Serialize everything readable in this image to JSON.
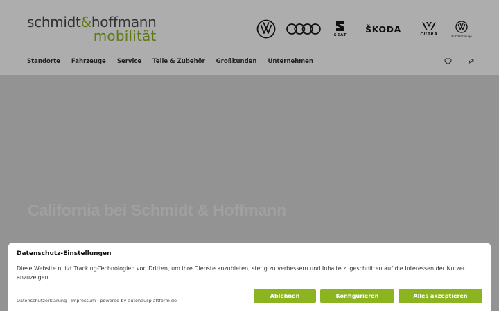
{
  "logo": {
    "line1_part1": "schmidt",
    "line1_amp": "&",
    "line1_part2": "hoffmann",
    "line2": "mobilität"
  },
  "brands": [
    {
      "icon": "vw-logo",
      "label": ""
    },
    {
      "icon": "audi-logo",
      "label": ""
    },
    {
      "icon": "seat-logo",
      "label": "SEAT"
    },
    {
      "icon": "skoda-logo",
      "label": "ŠKODA"
    },
    {
      "icon": "cupra-logo",
      "label": "CUPRA"
    },
    {
      "icon": "vw-nutzfahrzeuge-logo",
      "label": "Nutzfahrzeuge"
    }
  ],
  "nav": {
    "items": [
      "Standorte",
      "Fahrzeuge",
      "Service",
      "Teile & Zubehör",
      "Großkunden",
      "Unternehmen"
    ]
  },
  "hero": {
    "title": "California bei Schmidt & Hoffmann"
  },
  "consent": {
    "title": "Datenschutz-Einstellungen",
    "text": "Diese Website nutzt Tracking-Technologien von Dritten, um ihre Dienste anzubieten, stetig zu verbessern und Inhalte zugeschnitten auf die Interessen der Nutzer anzuzeigen.",
    "link_privacy": "Datenschutzerklärung",
    "link_imprint": "Impressum",
    "powered_by": "powered by autohausplattform.de",
    "button_decline": "Ablehnen",
    "button_configure": "Konfigurieren",
    "button_accept": "Alles akzeptieren"
  },
  "colors": {
    "accent": "#8cb320",
    "text_dark": "#333333",
    "hero_bg": "#d9d9d9"
  }
}
